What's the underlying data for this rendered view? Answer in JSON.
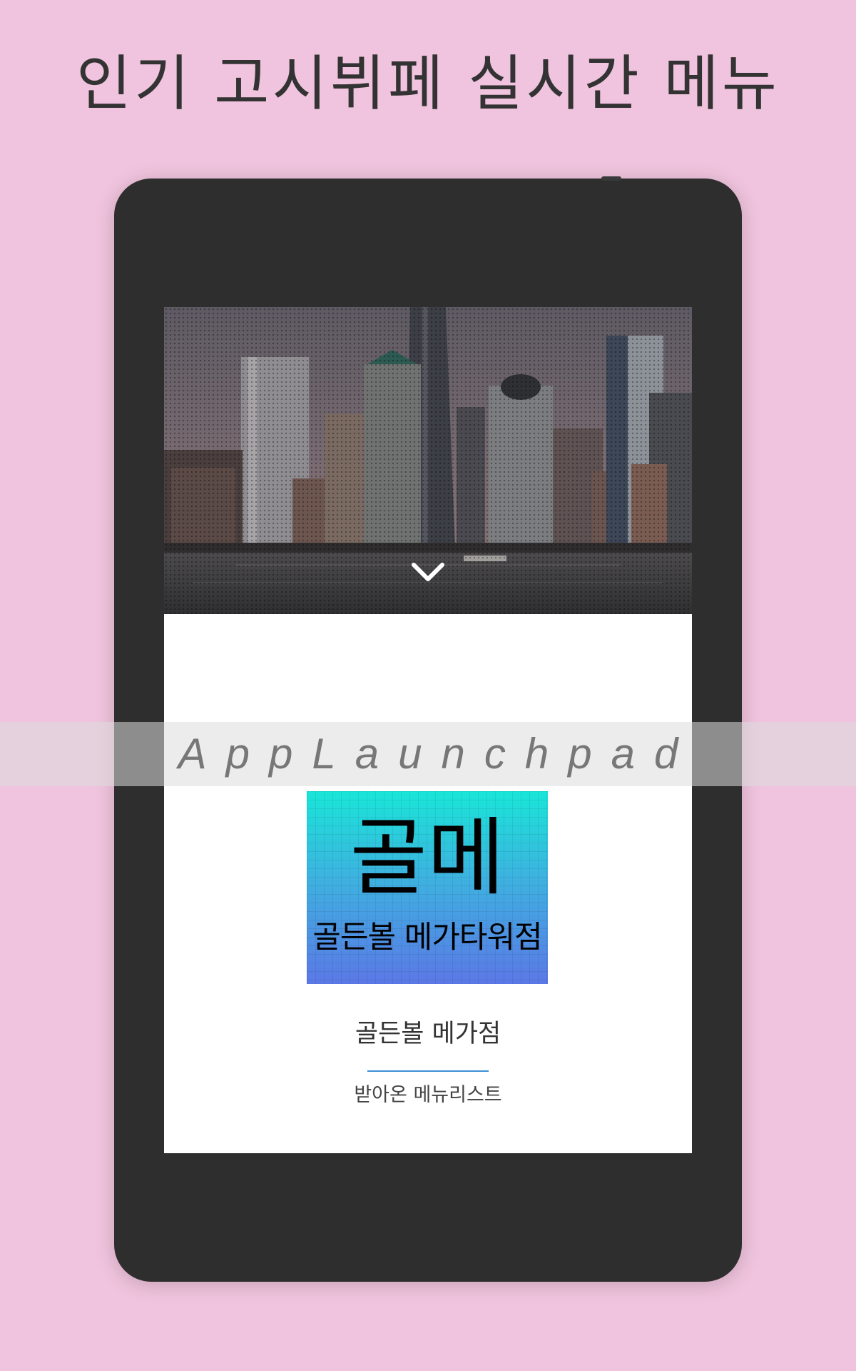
{
  "headline": "인기 고시뷔페 실시간 메뉴",
  "app": {
    "logo": {
      "main": "골메",
      "sub": "골든볼  메가타워점",
      "gradient_top": "#19e6d8",
      "gradient_bottom": "#5b78e6"
    },
    "store_name": "골든볼 메가점",
    "menu_list_link": "받아온 메뉴리스트",
    "accent_color": "#3d8fd6",
    "hero_icon": "chevron-down-icon"
  },
  "watermark": "AppLaunchpad",
  "colors": {
    "background": "#f0c4de",
    "device": "#2e2e2e"
  }
}
